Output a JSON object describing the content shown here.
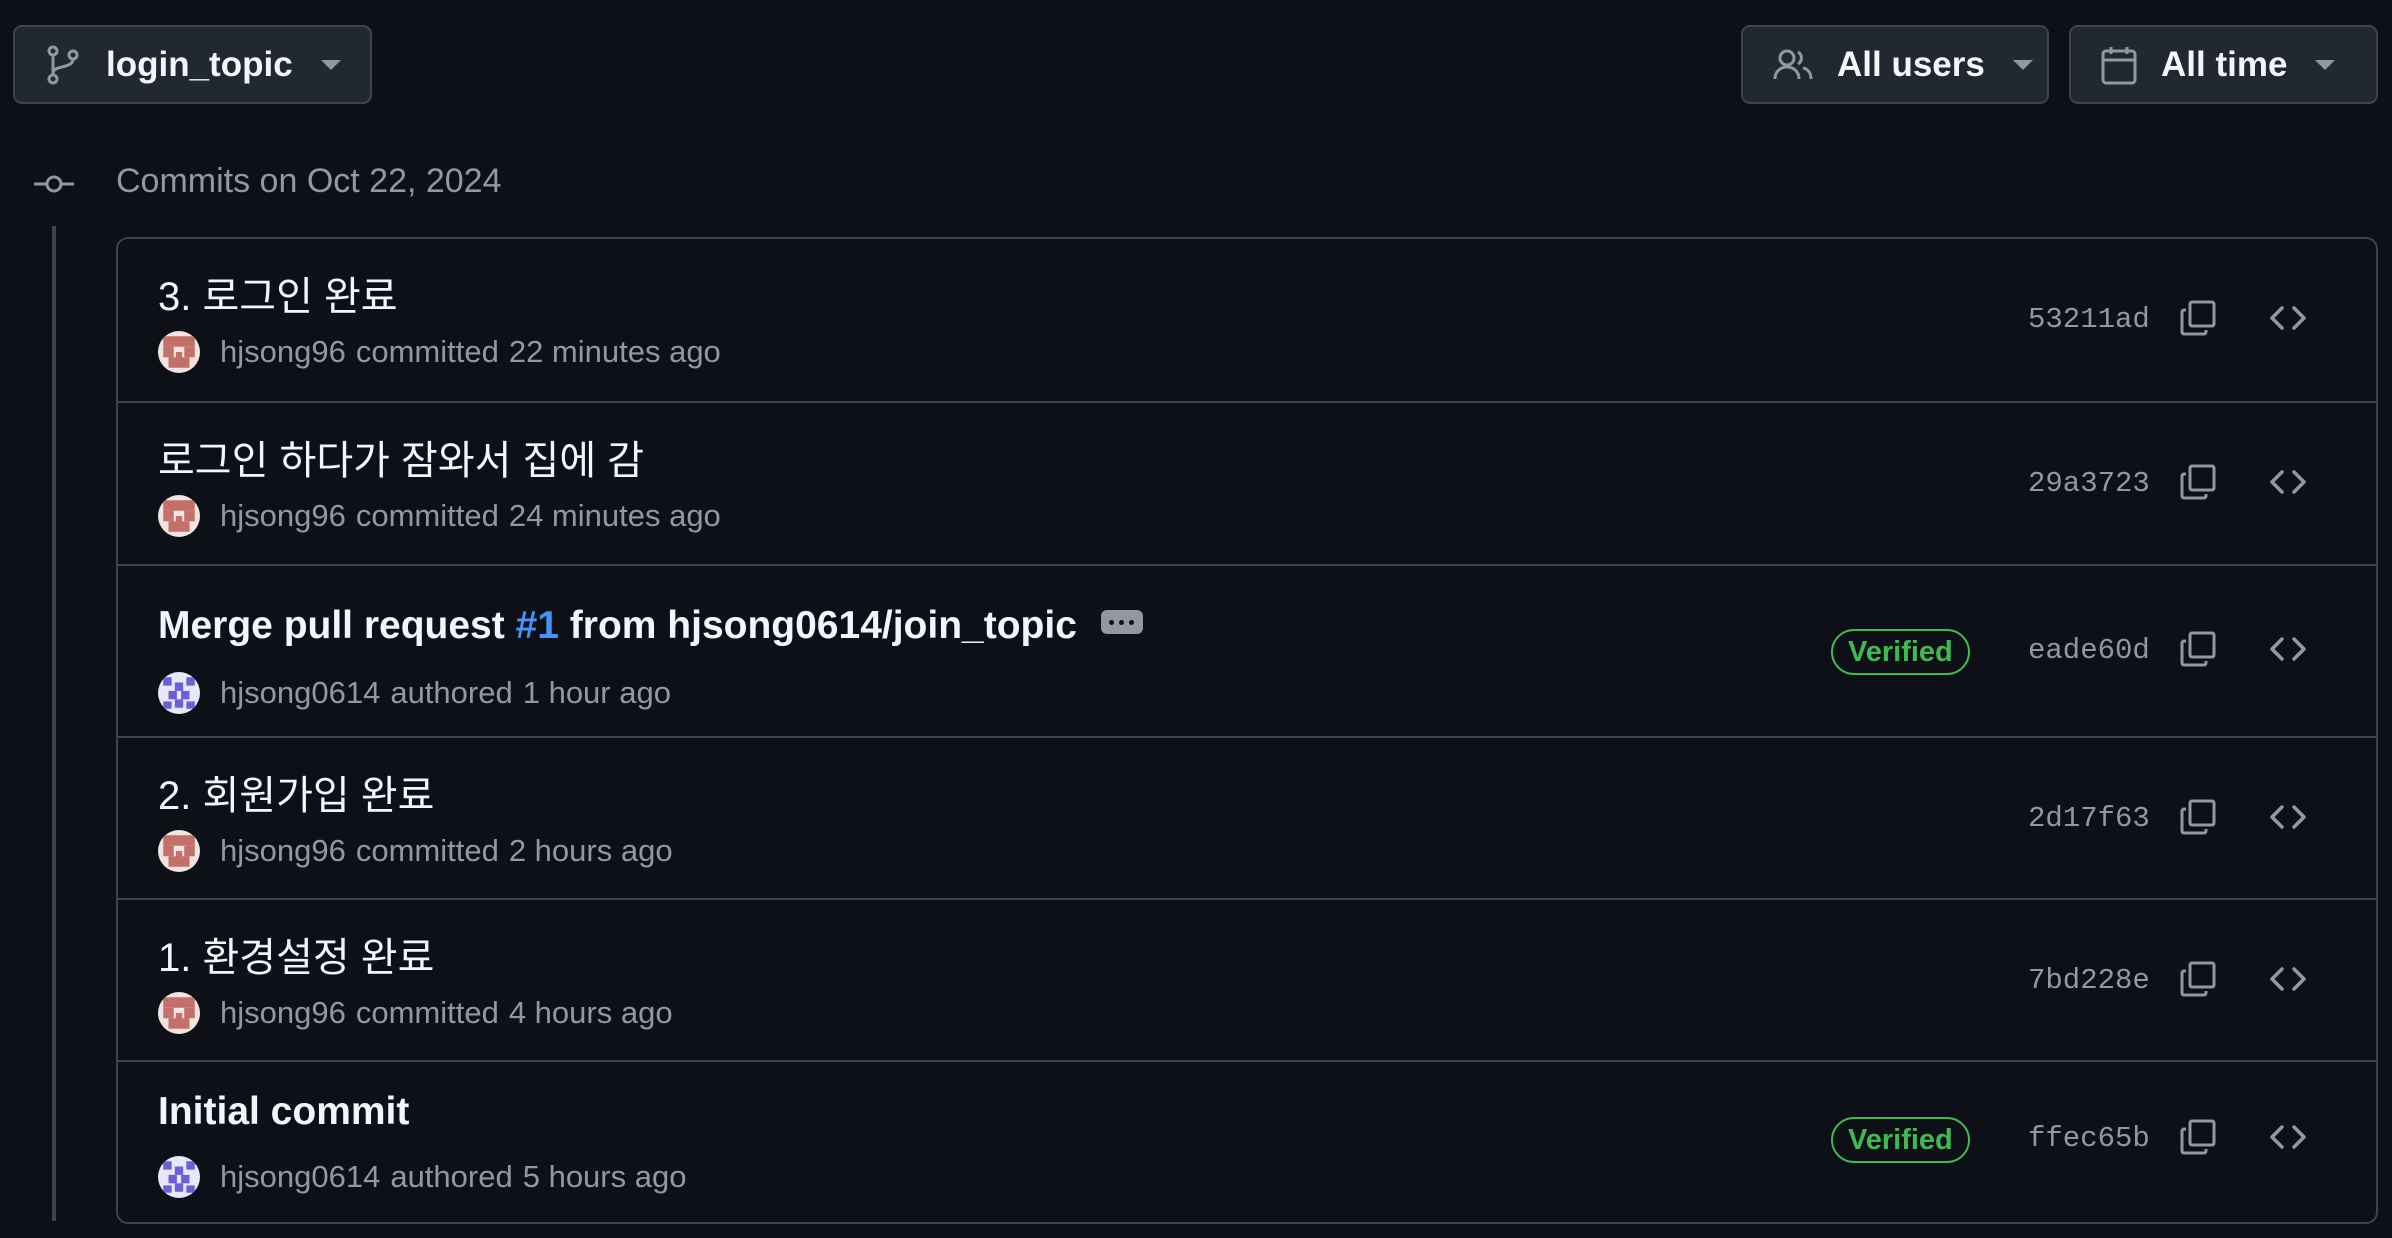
{
  "toolbar": {
    "branch": "login_topic",
    "users_filter": "All users",
    "time_filter": "All time"
  },
  "timeline": {
    "date_heading": "Commits on Oct 22, 2024"
  },
  "colors": {
    "background": "#0d1117",
    "border": "#3d444d",
    "link": "#4493f8",
    "verified": "#3fb950",
    "muted": "#9198a1"
  },
  "commits": [
    {
      "title": "3. 로그인 완료",
      "author": "hjsong96",
      "verb": "committed",
      "time": "22 minutes ago",
      "sha": "53211ad",
      "verified": false,
      "avatar": "hjsong96-avatar"
    },
    {
      "title": "로그인 하다가 잠와서 집에 감",
      "author": "hjsong96",
      "verb": "committed",
      "time": "24 minutes ago",
      "sha": "29a3723",
      "verified": false,
      "avatar": "hjsong96-avatar"
    },
    {
      "title_prefix": "Merge pull request ",
      "pr_link": "#1",
      "title_suffix": " from hjsong0614/join_topic",
      "author": "hjsong0614",
      "verb": "authored",
      "time": "1 hour ago",
      "sha": "eade60d",
      "verified": true,
      "verified_label": "Verified",
      "avatar": "hjsong0614-avatar"
    },
    {
      "title": "2. 회원가입 완료",
      "author": "hjsong96",
      "verb": "committed",
      "time": "2 hours ago",
      "sha": "2d17f63",
      "verified": false,
      "avatar": "hjsong96-avatar"
    },
    {
      "title": "1. 환경설정 완료",
      "author": "hjsong96",
      "verb": "committed",
      "time": "4 hours ago",
      "sha": "7bd228e",
      "verified": false,
      "avatar": "hjsong96-avatar"
    },
    {
      "title": "Initial commit",
      "author": "hjsong0614",
      "verb": "authored",
      "time": "5 hours ago",
      "sha": "ffec65b",
      "verified": true,
      "verified_label": "Verified",
      "avatar": "hjsong0614-avatar"
    }
  ]
}
